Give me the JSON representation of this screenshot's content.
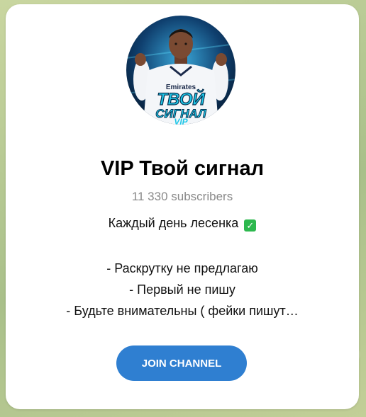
{
  "channel": {
    "name": "VIP Твой сигнал",
    "subscribers": "11 330 subscribers",
    "avatar_text_line1": "ТВОЙ",
    "avatar_text_line2": "СИГНАЛ",
    "avatar_text_line3": "VIP",
    "avatar_shirt_text": "Emirates"
  },
  "description": {
    "line1": "Каждый день лесенка",
    "line1_emoji": "check-mark-button-icon",
    "line2": "- Раскрутку не предлагаю",
    "line3": "- Первый не пишу",
    "line4": "- Будьте внимательны ( фейки пишут…"
  },
  "actions": {
    "join_label": "JOIN CHANNEL"
  },
  "colors": {
    "accent": "#2f7fd1",
    "subscribers_text": "#8a8a8a",
    "emoji_green": "#2db84e",
    "avatar_text": "#1ec7e8"
  }
}
